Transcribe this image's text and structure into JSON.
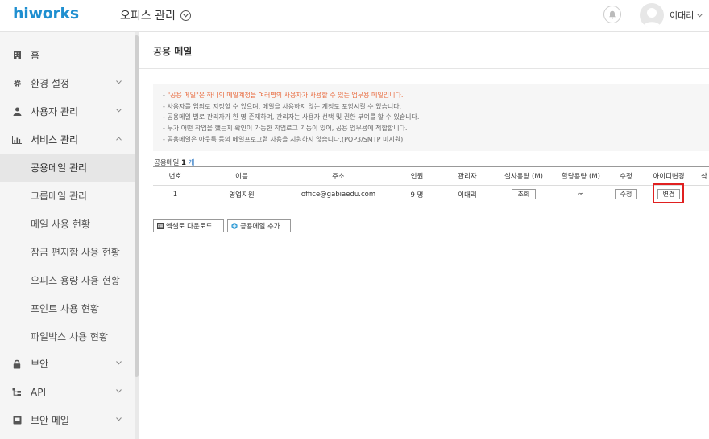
{
  "app": {
    "logo": "hiworks",
    "office_menu": "오피스 관리",
    "user_name": "이대리"
  },
  "sidebar": {
    "items": [
      {
        "label": "홈"
      },
      {
        "label": "환경 설정"
      },
      {
        "label": "사용자 관리"
      },
      {
        "label": "서비스 관리"
      },
      {
        "label": "보안"
      },
      {
        "label": "API"
      },
      {
        "label": "보안 메일"
      }
    ],
    "service_sub": [
      {
        "label": "공용메일 관리",
        "active": true
      },
      {
        "label": "그룹메일 관리"
      },
      {
        "label": "메일 사용 현황"
      },
      {
        "label": "잠금 편지함 사용 현황"
      },
      {
        "label": "오피스 용량 사용 현황"
      },
      {
        "label": "포인트 사용 현황"
      },
      {
        "label": "파일박스 사용 현황"
      }
    ]
  },
  "page": {
    "title": "공용 메일",
    "notice": {
      "line1_highlight": "\"공용 메일\"은 하나의 메일계정을 여러명의 사용자가 사용할 수 있는 업무용 메일입니다.",
      "line2": "사용자를 임의로 지정할 수 있으며, 메일을 사용하지 않는 계정도 포함시킬 수 있습니다.",
      "line3": "공용메일 별로 관리자가 한 명 존재하며, 관리자는 사용자 선택 및 권한 부여를 할 수 있습니다.",
      "line4": "누가 어떤 작업을 했는지 확인이 가능한 작업로그 기능이 있어, 공용 업무용에 적합합니다.",
      "line5": "공용메일은 아웃룩 등의 메일프로그램 사용을 지원하지 않습니다.(POP3/SMTP 미지원)"
    },
    "count": {
      "label": "공용메일",
      "value": "1",
      "unit": "개"
    },
    "table": {
      "headers": {
        "no": "번호",
        "name": "이름",
        "address": "주소",
        "members": "인원",
        "manager": "관리자",
        "actual": "실사용량 (M)",
        "quota": "할당용량 (M)",
        "edit": "수정",
        "id_change": "아이디변경",
        "delete": "삭"
      },
      "rows": [
        {
          "no": "1",
          "name": "영업지원",
          "address": "office@gabiaedu.com",
          "members": "9 명",
          "manager": "이대리",
          "actual_btn": "조회",
          "quota": "∞",
          "edit_btn": "수정",
          "id_change_btn": "변경"
        }
      ]
    },
    "actions": {
      "excel": "엑셀로 다운로드",
      "add": "공용메일 추가"
    }
  }
}
